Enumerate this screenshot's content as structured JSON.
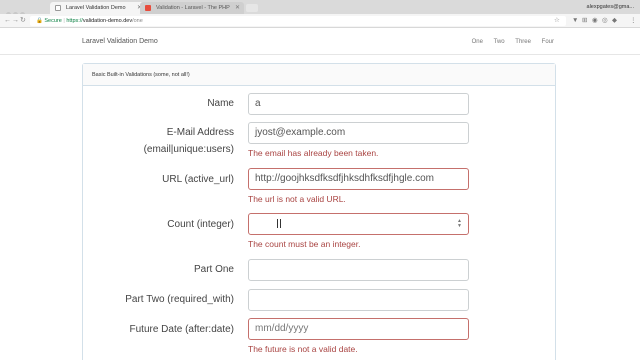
{
  "browser": {
    "tabs": [
      {
        "label": "Laravel Validation Demo",
        "active": true
      },
      {
        "label": "Validation - Laravel - The PHP",
        "active": false
      }
    ],
    "profile": "alexpgates@gma...",
    "secure_label": "Secure",
    "url_scheme": "https://",
    "url_host": "validation-demo.dev",
    "url_path": "/one"
  },
  "navbar": {
    "brand": "Laravel Validation Demo",
    "links": [
      "One",
      "Two",
      "Three",
      "Four"
    ]
  },
  "panel": {
    "heading": "Basic Built-in Validations (some, not all!)"
  },
  "form": {
    "name": {
      "label": "Name",
      "value": "a"
    },
    "email": {
      "label1": "E-Mail Address",
      "label2": "(email|unique:users)",
      "value": "jyost@example.com",
      "error": "The email has already been taken."
    },
    "url": {
      "label": "URL (active_url)",
      "value": "http://goojhksdfksdfjhksdhfksdfjhgle.com",
      "error": "The url is not a valid URL."
    },
    "count": {
      "label": "Count (integer)",
      "value": "",
      "error": "The count must be an integer."
    },
    "part_one": {
      "label": "Part One",
      "value": ""
    },
    "part_two": {
      "label": "Part Two (required_with)",
      "value": ""
    },
    "future_date": {
      "label": "Future Date (after:date)",
      "placeholder": "mm/dd/yyyy",
      "error": "The future is not a valid date."
    }
  },
  "colors": {
    "error": "#a94442",
    "error_border": "#c5706c",
    "secure": "#0b8043"
  }
}
